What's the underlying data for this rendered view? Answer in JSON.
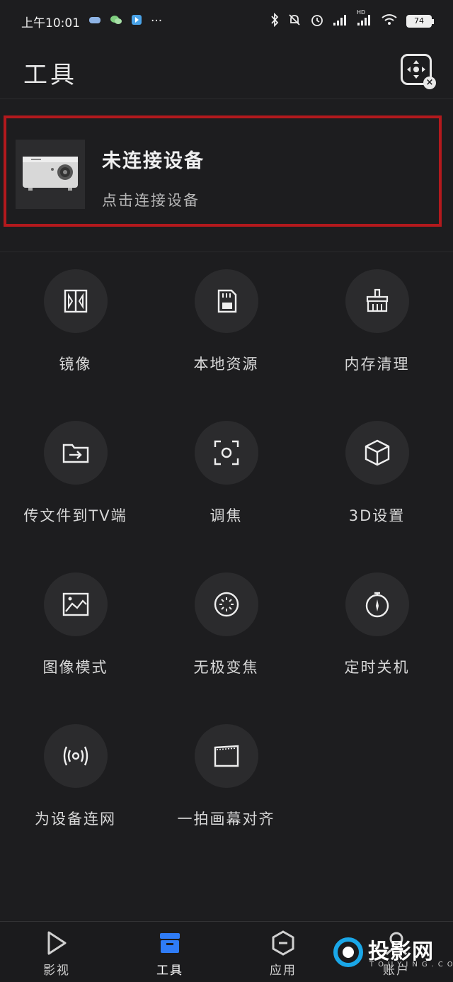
{
  "status_bar": {
    "time": "上午10:01",
    "dots": "···",
    "battery": "74",
    "network_badge": "HD"
  },
  "header": {
    "title": "工具"
  },
  "device_card": {
    "title": "未连接设备",
    "subtitle": "点击连接设备"
  },
  "tools": [
    {
      "label": "镜像",
      "icon": "mirror-icon"
    },
    {
      "label": "本地资源",
      "icon": "sd-card-icon"
    },
    {
      "label": "内存清理",
      "icon": "broom-icon"
    },
    {
      "label": "传文件到TV端",
      "icon": "folder-transfer-icon"
    },
    {
      "label": "调焦",
      "icon": "focus-icon"
    },
    {
      "label": "3D设置",
      "icon": "cube-icon"
    },
    {
      "label": "图像模式",
      "icon": "image-icon"
    },
    {
      "label": "无极变焦",
      "icon": "zoom-dial-icon"
    },
    {
      "label": "定时关机",
      "icon": "timer-icon"
    },
    {
      "label": "为设备连网",
      "icon": "broadcast-icon"
    },
    {
      "label": "一拍画幕对齐",
      "icon": "screen-align-icon"
    }
  ],
  "bottom_nav": [
    {
      "label": "影视",
      "icon": "play-icon"
    },
    {
      "label": "工具",
      "icon": "toolbox-icon",
      "active": true
    },
    {
      "label": "应用",
      "icon": "apps-icon"
    },
    {
      "label": "账户",
      "icon": "account-icon"
    }
  ],
  "watermark": {
    "text": "投影网",
    "sub": "TOUYING.COM"
  },
  "colors": {
    "background": "#1d1d1f",
    "accent_active": "#2f7cf6",
    "highlight_border": "#b3191d"
  }
}
